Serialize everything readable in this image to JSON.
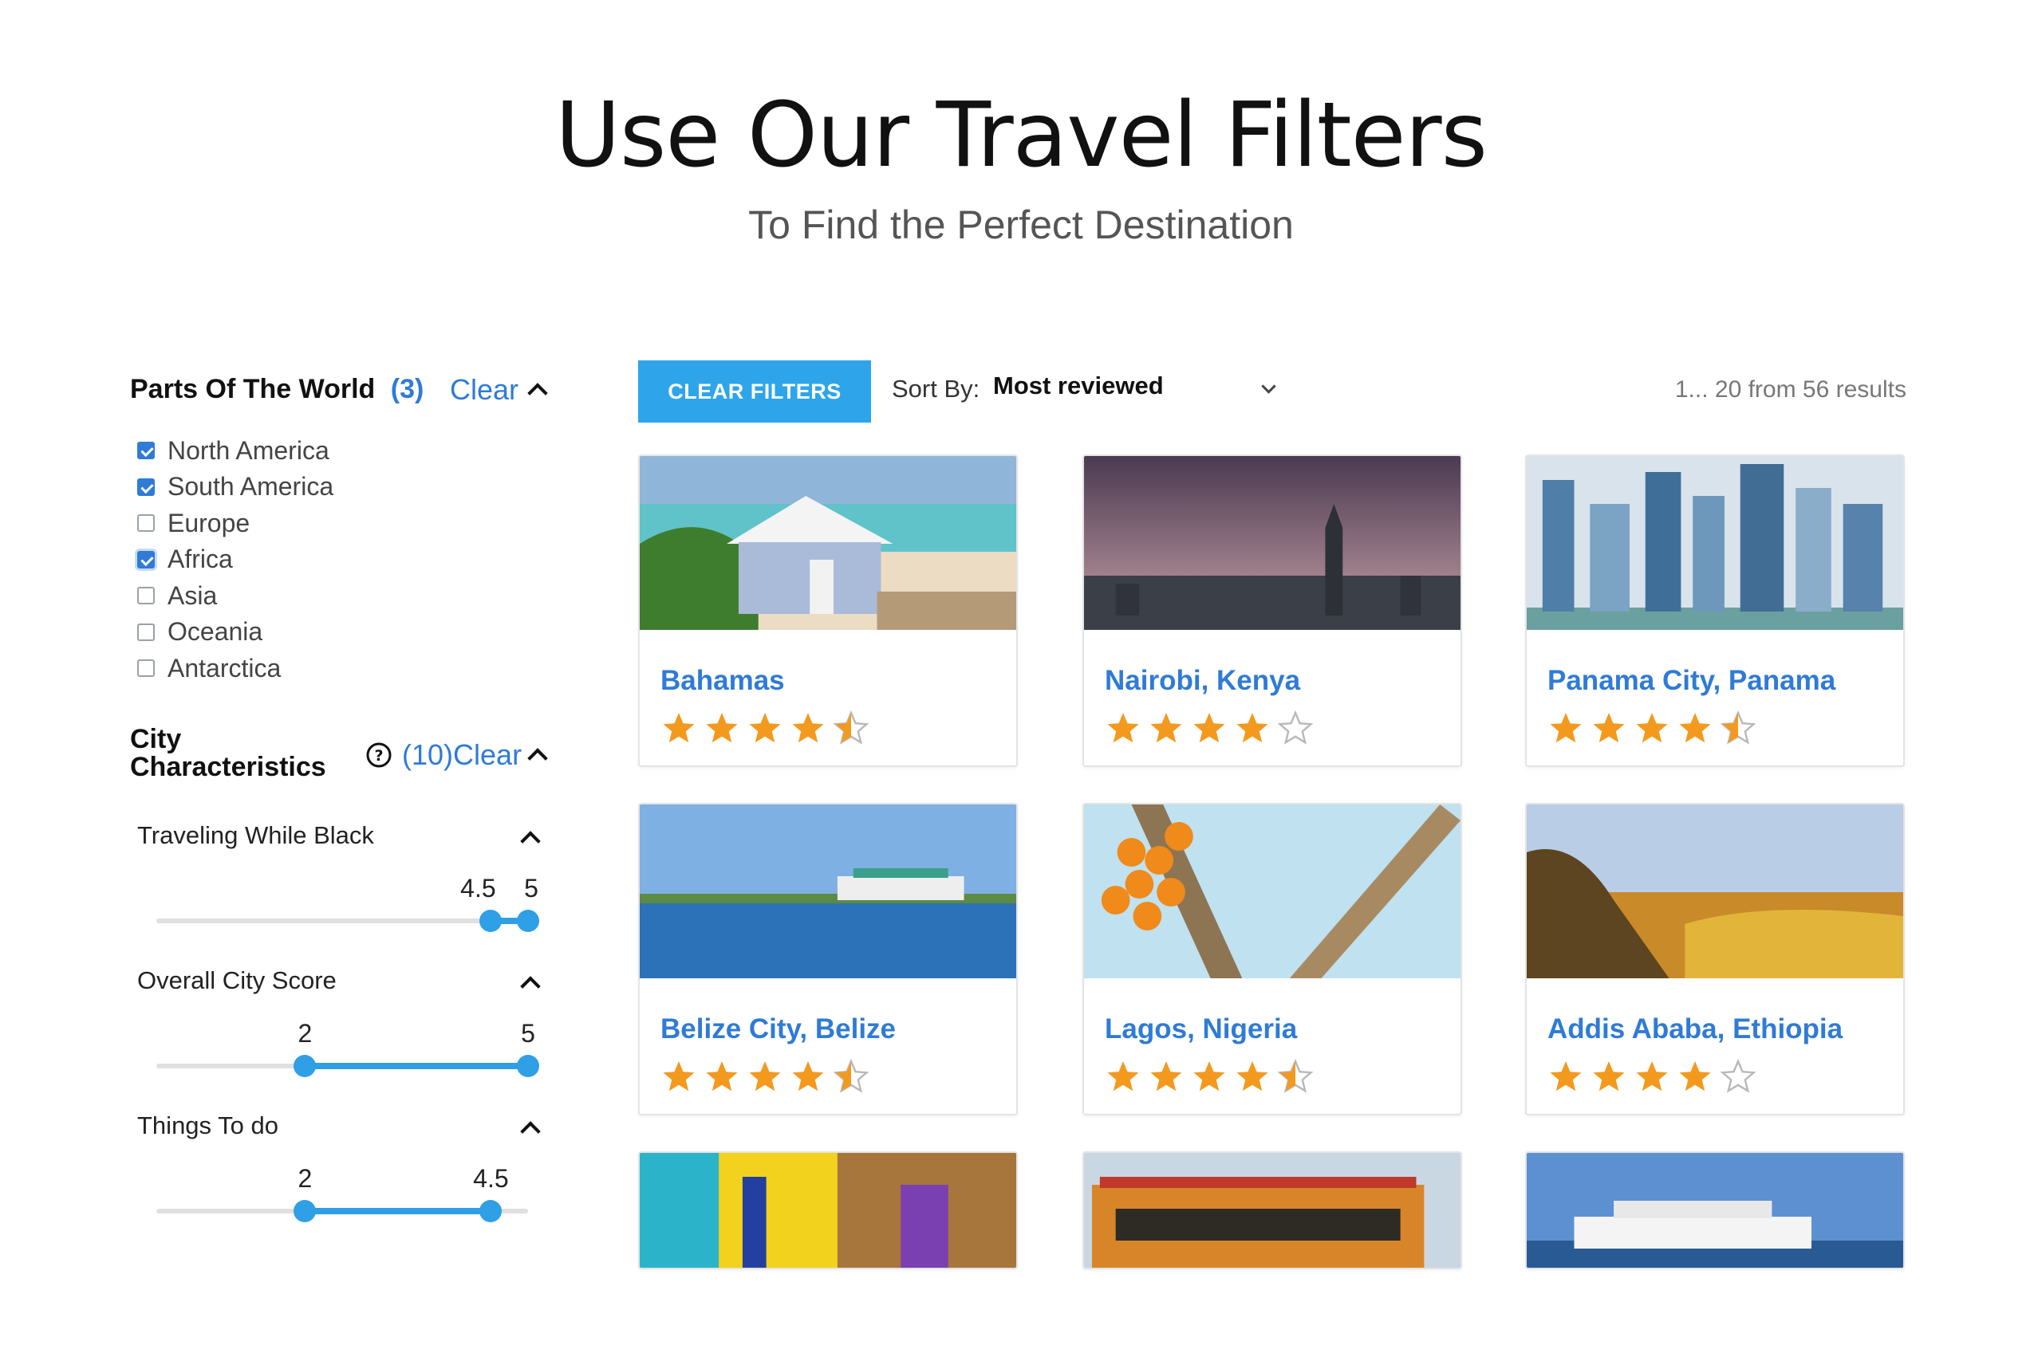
{
  "hero": {
    "title": "Use Our Travel Filters",
    "subtitle": "To Find the Perfect Destination"
  },
  "sidebar": {
    "parts_of_world": {
      "title": "Parts Of The World",
      "count": "(3)",
      "clear_label": "Clear",
      "options": [
        {
          "label": "North America",
          "checked": true
        },
        {
          "label": "South America",
          "checked": true
        },
        {
          "label": "Europe",
          "checked": false
        },
        {
          "label": "Africa",
          "checked": true
        },
        {
          "label": "Asia",
          "checked": false
        },
        {
          "label": "Oceania",
          "checked": false
        },
        {
          "label": "Antarctica",
          "checked": false
        }
      ]
    },
    "city_characteristics": {
      "title_line1": "City",
      "title_line2": "Characteristics",
      "help_icon": "question-circle-icon",
      "count": "(10)",
      "clear_label": "Clear",
      "ranges": [
        {
          "label": "Traveling While Black",
          "min": "4.5",
          "max": "5",
          "low": 4.5,
          "high": 5
        },
        {
          "label": "Overall City Score",
          "min": "2",
          "max": "5",
          "low": 2,
          "high": 5
        },
        {
          "label": "Things To do",
          "min": "2",
          "max": "4.5",
          "low": 2,
          "high": 4.5
        }
      ],
      "scale_min": 0,
      "scale_max": 5
    }
  },
  "toolbar": {
    "clear_filters_label": "CLEAR FILTERS",
    "sort_label": "Sort By:",
    "sort_value": "Most reviewed",
    "results_text": "1... 20 from 56 results"
  },
  "colors": {
    "accent_blue": "#2f7bd6",
    "button_blue": "#2ea5ea",
    "star_orange": "#f39a1e"
  },
  "destinations": [
    {
      "name": "Bahamas",
      "rating": 4.5
    },
    {
      "name": "Nairobi, Kenya",
      "rating": 4
    },
    {
      "name": "Panama City, Panama",
      "rating": 4.5
    },
    {
      "name": "Belize City, Belize",
      "rating": 4.5
    },
    {
      "name": "Lagos, Nigeria",
      "rating": 4.5
    },
    {
      "name": "Addis Ababa, Ethiopia",
      "rating": 4
    }
  ]
}
